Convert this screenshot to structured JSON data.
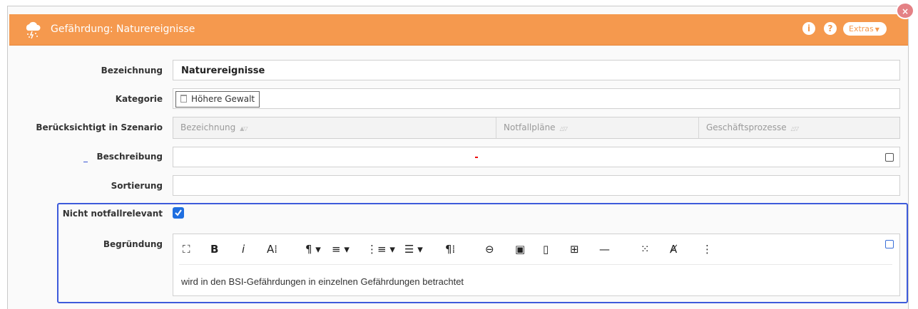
{
  "header": {
    "title": "Gefährdung: Naturereignisse",
    "extras_label": "Extras",
    "info_glyph": "i",
    "help_glyph": "?",
    "close_glyph": "×",
    "brand_color": "#f5994e"
  },
  "form": {
    "bezeichnung": {
      "label": "Bezeichnung",
      "value": "Naturereignisse"
    },
    "kategorie": {
      "label": "Kategorie",
      "tag": "Höhere Gewalt"
    },
    "szenario": {
      "label": "Berücksichtigt in Szenario",
      "columns": [
        "Bezeichnung",
        "Notfallpläne",
        "Geschäftsprozesse"
      ]
    },
    "beschreibung": {
      "label": "Beschreibung",
      "value": ""
    },
    "sortierung": {
      "label": "Sortierung",
      "value": ""
    },
    "nicht_notfallrelevant": {
      "label": "Nicht notfallrelevant",
      "checked": true
    },
    "begruendung": {
      "label": "Begründung",
      "text": "wird in den BSI-Gefährdungen in einzelnen Gefährdungen betrachtet"
    }
  },
  "toolbar": {
    "fullscreen": "⛶",
    "bold": "B",
    "italic": "i",
    "font_size": "A⁞",
    "paragraph": "¶ ▾",
    "align": "≡ ▾",
    "ordered_list": "⋮≡ ▾",
    "unordered_list": "☰ ▾",
    "paragraph_style": "¶⁞",
    "link": "⊖",
    "image": "▣",
    "file": "▯",
    "table": "⊞",
    "hr": "—",
    "select_all": "⁙",
    "clear_format": "Ⱥ",
    "more": "⋮"
  },
  "highlight_color": "#3d5bdb"
}
